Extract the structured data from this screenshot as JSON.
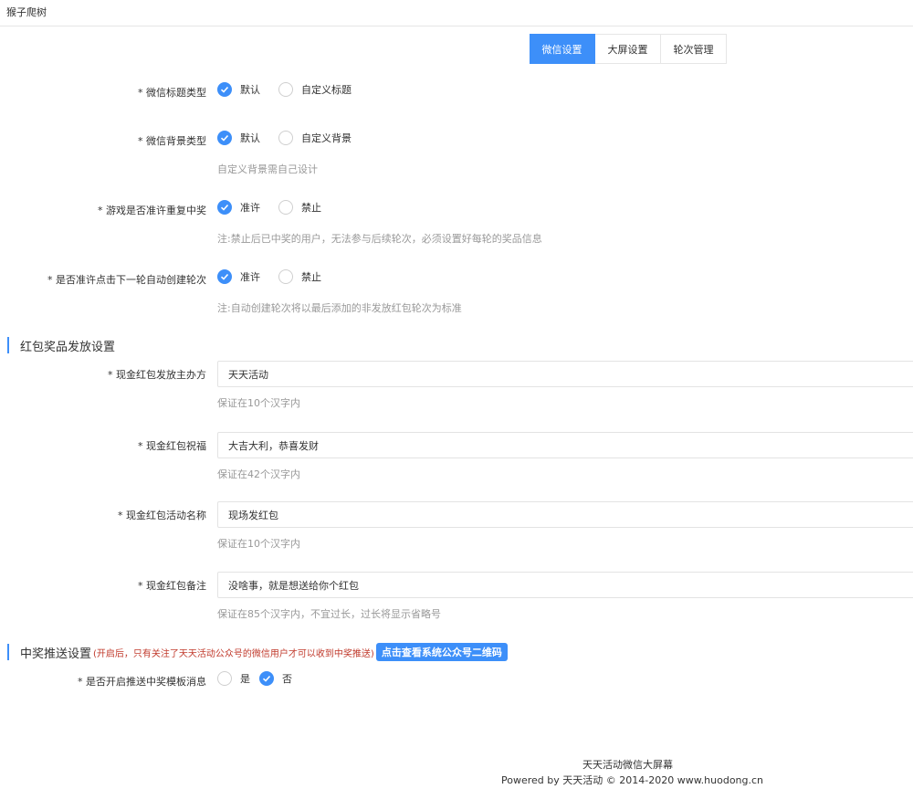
{
  "header": {
    "title": "猴子爬树"
  },
  "tabs": [
    {
      "label": "微信设置",
      "active": true
    },
    {
      "label": "大屏设置",
      "active": false
    },
    {
      "label": "轮次管理",
      "active": false
    }
  ],
  "settings": {
    "title_type": {
      "label": "* 微信标题类型",
      "options": [
        "默认",
        "自定义标题"
      ],
      "selected": 0
    },
    "bg_type": {
      "label": "* 微信背景类型",
      "options": [
        "默认",
        "自定义背景"
      ],
      "selected": 0,
      "hint": "自定义背景需自己设计"
    },
    "repeat_win": {
      "label": "* 游戏是否准许重复中奖",
      "options": [
        "准许",
        "禁止"
      ],
      "selected": 0,
      "hint": "注:禁止后已中奖的用户，无法参与后续轮次，必须设置好每轮的奖品信息"
    },
    "auto_round": {
      "label": "* 是否准许点击下一轮自动创建轮次",
      "options": [
        "准许",
        "禁止"
      ],
      "selected": 0,
      "hint": "注:自动创建轮次将以最后添加的非发放红包轮次为标准"
    }
  },
  "redpack_section": {
    "title": "红包奖品发放设置",
    "sponsor": {
      "label": "* 现金红包发放主办方",
      "value": "天天活动",
      "hint": "保证在10个汉字内"
    },
    "wish": {
      "label": "* 现金红包祝福",
      "value": "大吉大利，恭喜发财",
      "hint": "保证在42个汉字内"
    },
    "activity": {
      "label": "* 现金红包活动名称",
      "value": "现场发红包",
      "hint": "保证在10个汉字内"
    },
    "remark": {
      "label": "* 现金红包备注",
      "value": "没啥事，就是想送给你个红包",
      "hint": "保证在85个汉字内，不宜过长，过长将显示省略号"
    }
  },
  "push_section": {
    "title": "中奖推送设置",
    "note": "(开启后，只有关注了天天活动公众号的微信用户才可以收到中奖推送)",
    "qr_button": "点击查看系统公众号二维码",
    "enable": {
      "label": "* 是否开启推送中奖模板消息",
      "options": [
        "是",
        "否"
      ],
      "selected": 1
    }
  },
  "footer": {
    "line1": "天天活动微信大屏幕",
    "line2": "Powered by 天天活动 © 2014-2020 www.huodong.cn"
  },
  "colors": {
    "accent": "#3d8ff9",
    "note_red": "#c0392b"
  }
}
